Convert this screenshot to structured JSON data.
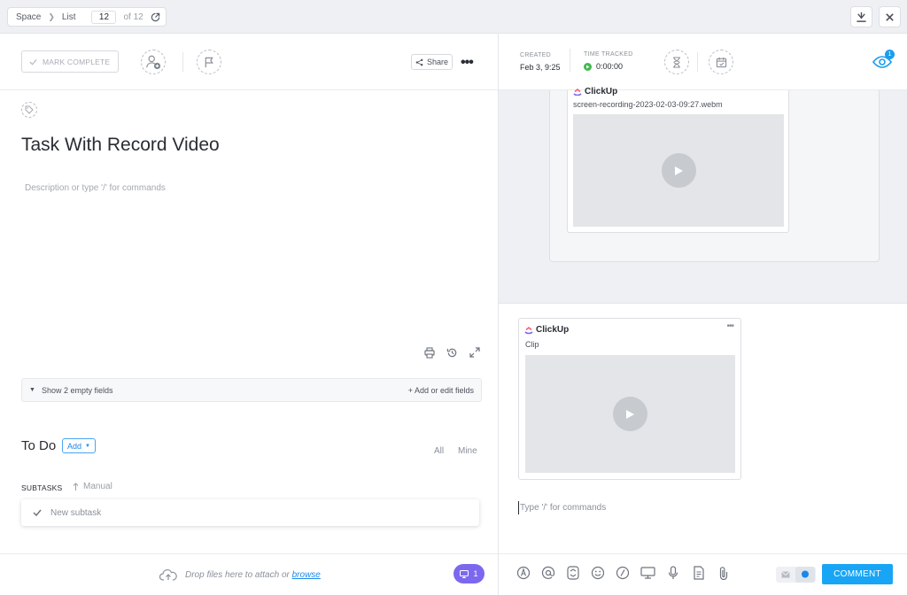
{
  "topbar": {
    "crumbs": [
      "Space",
      "List"
    ],
    "page_current": "12",
    "page_total_text": "of 12"
  },
  "task": {
    "mark_complete_label": "MARK COMPLETE",
    "share_label": "Share",
    "more_label": "•••",
    "title": "Task With Record Video",
    "description_placeholder": "Description or type '/' for commands",
    "show_empty_fields": "Show 2 empty fields",
    "add_edit_fields": "+ Add or edit fields",
    "status": "To Do",
    "add_label": "Add",
    "filter_all": "All",
    "filter_mine": "Mine",
    "subtasks_label": "SUBTASKS",
    "sort_label": "Manual",
    "new_subtask_placeholder": "New subtask"
  },
  "footer_left": {
    "drop_text": "Drop files here to attach or",
    "browse_label": "browse",
    "comment_count": "1"
  },
  "meta": {
    "created_label": "CREATED",
    "created_value": "Feb 3, 9:25",
    "time_tracked_label": "TIME TRACKED",
    "time_tracked_value": "0:00:00",
    "watchers_count": "1"
  },
  "activity": {
    "brand": "ClickUp",
    "filename": "screen-recording-2023-02-03-09:27.webm"
  },
  "composer": {
    "clip_brand": "ClickUp",
    "clip_title": "Clip",
    "clip_more": "•••",
    "placeholder": "Type '/' for commands",
    "comment_button": "COMMENT"
  },
  "colors": {
    "accent": "#7b68ee",
    "primary": "#19a5f5",
    "link": "#1b88e8",
    "tracking_green": "#3fb950"
  }
}
